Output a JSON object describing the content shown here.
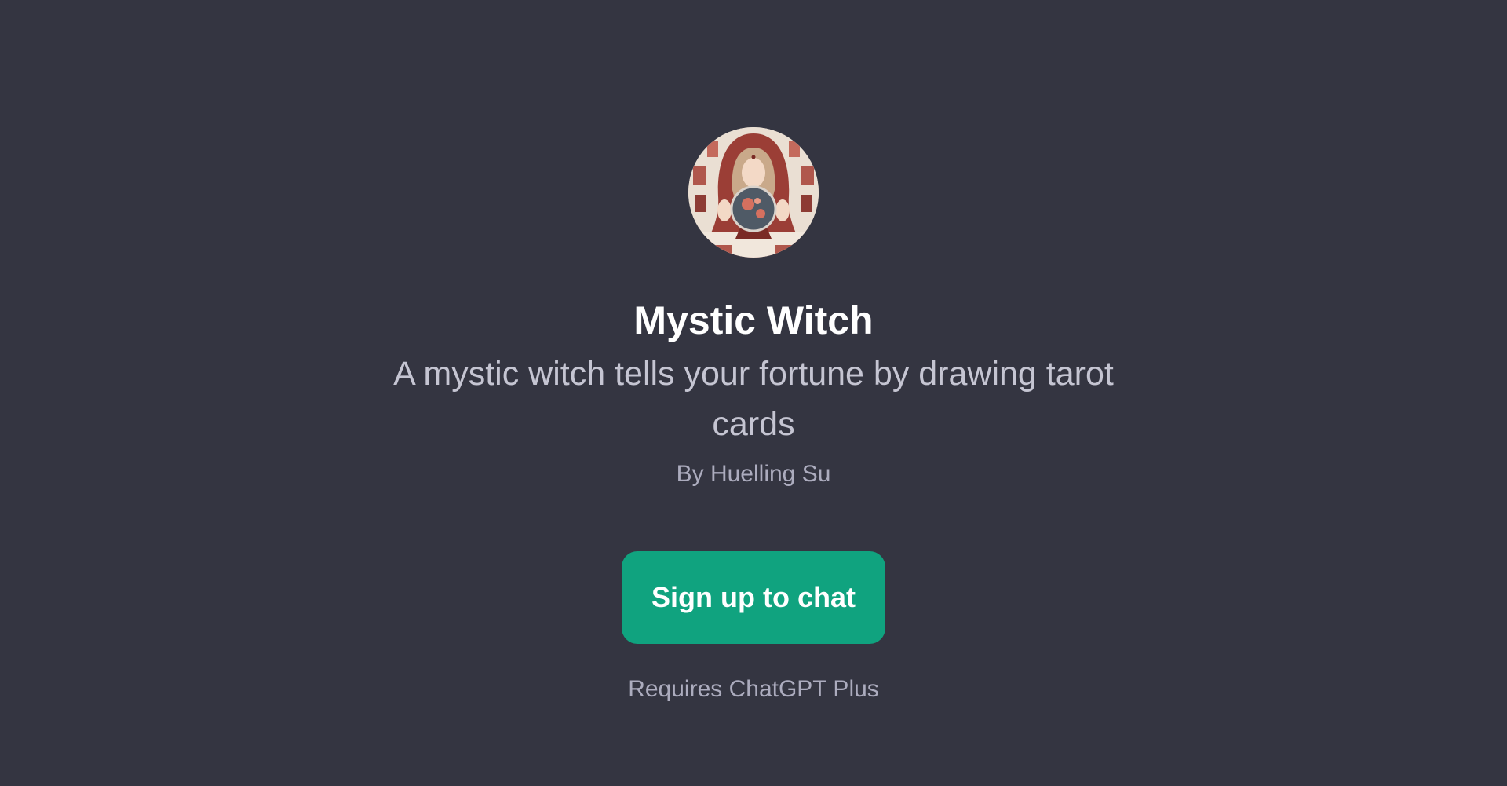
{
  "colors": {
    "background": "#343541",
    "title": "#ffffff",
    "description": "#c5c5d2",
    "muted": "#acacbe",
    "accent": "#10a37f"
  },
  "gpt": {
    "avatar_icon": "mystic-witch-avatar",
    "title": "Mystic Witch",
    "description": "A mystic witch tells your fortune by drawing tarot cards",
    "author": "By Huelling Su"
  },
  "actions": {
    "signup_label": "Sign up to chat",
    "requirement_note": "Requires ChatGPT Plus"
  }
}
